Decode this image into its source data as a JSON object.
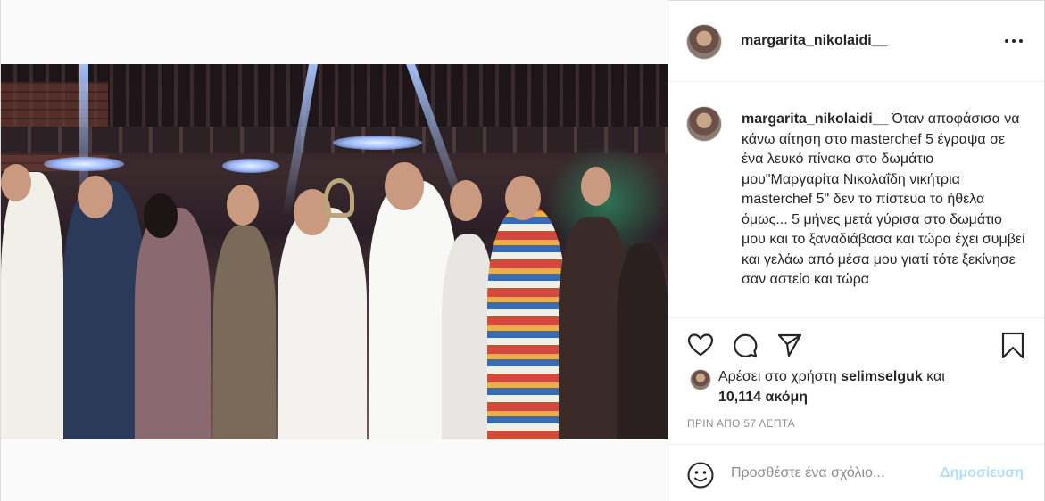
{
  "post": {
    "username": "margarita_nikolaidi__",
    "more_options": "more-options-icon"
  },
  "caption": {
    "username": "margarita_nikolaidi__",
    "text": "Όταν αποφάσισα να κάνω αίτηση στο masterchef 5 έγραψα σε ένα λευκό πίνακα στο δωμάτιο μου\"Μαργαρίτα Νικολαΐδη νικήτρια masterchef 5\" δεν το πίστευα το ήθελα όμως... 5 μήνες μετά γύρισα στο δωμάτιο μου και το ξαναδιάβασα και τώρα έχει συμβεί και γελάω από μέσα μου γιατί τότε ξεκίνησε σαν αστείο και τώρα"
  },
  "actions": {
    "like_icon": "heart-icon",
    "comment_icon": "comment-icon",
    "share_icon": "share-icon",
    "save_icon": "bookmark-icon"
  },
  "likes": {
    "prefix": "Αρέσει στο χρήστη",
    "user": "selimselguk",
    "conjunction": "και",
    "count_text": "10,114 ακόμη"
  },
  "timestamp": "ΠΡΙΝ ΑΠΟ 57 ΛΕΠΤΑ",
  "comment": {
    "placeholder": "Προσθέστε ένα σχόλιο...",
    "post_label": "Δημοσίευση"
  },
  "colors": {
    "text": "#262626",
    "secondary": "#8e8e8e",
    "post_button_disabled": "#b2dffc",
    "border": "#dbdbdb"
  }
}
